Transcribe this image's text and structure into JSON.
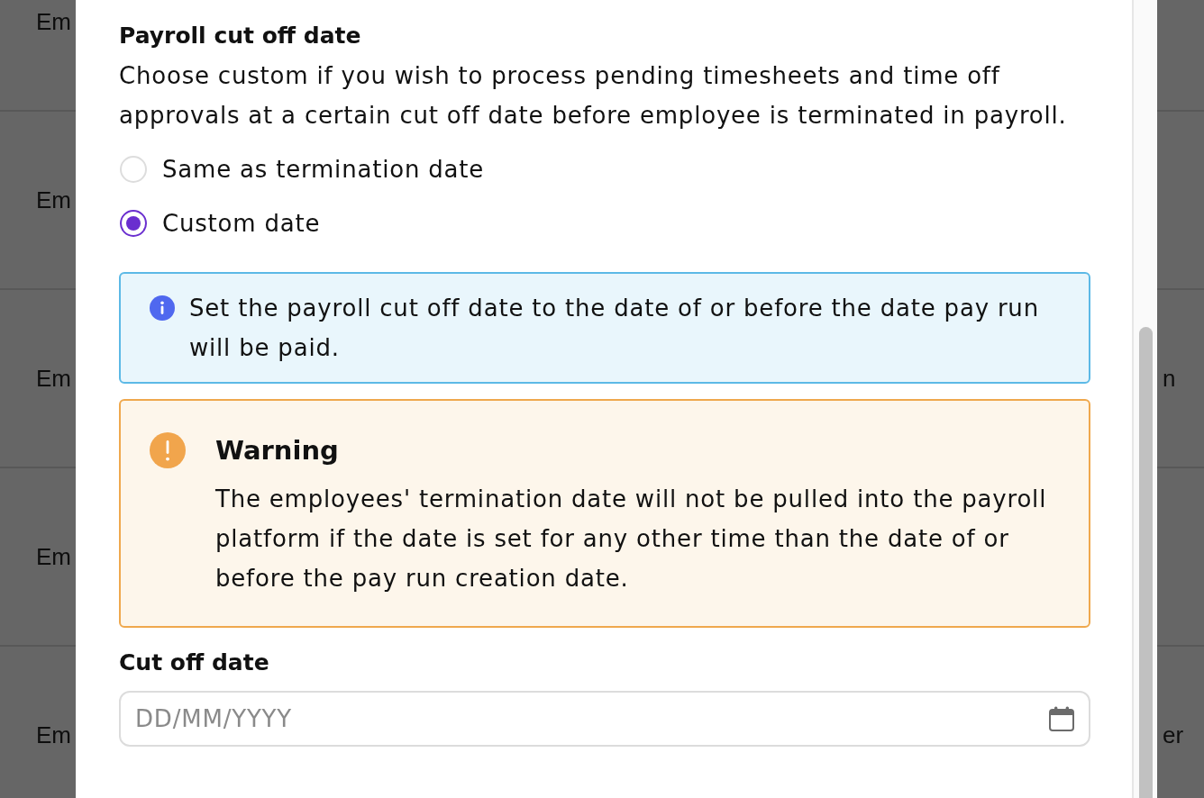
{
  "background_table": {
    "rows": [
      {
        "column_1": "Em"
      },
      {
        "column_1": "Em"
      },
      {
        "column_1": "Em",
        "column_2": "n"
      },
      {
        "column_1": "Em"
      },
      {
        "column_1": "Em",
        "column_2": "er"
      }
    ]
  },
  "modal": {
    "section": {
      "title": "Payroll cut off date",
      "description": "Choose custom if you wish to process pending timesheets and time off approvals at a certain cut off date before employee is terminated in payroll."
    },
    "cutoff_options": [
      {
        "label": "Same as termination date",
        "selected": false
      },
      {
        "label": "Custom date",
        "selected": true
      }
    ],
    "alerts": [
      {
        "kind": "info",
        "text": "Set the payroll cut off date to the date of or before the date pay run will be paid."
      },
      {
        "kind": "warning",
        "title": "Warning",
        "text": "The employees' termination date will not be pulled into the payroll platform if the date is set for any other time than the date of or before the pay run creation date."
      }
    ],
    "date_field": {
      "label": "Cut off date",
      "placeholder": "DD/MM/YYYY"
    }
  }
}
